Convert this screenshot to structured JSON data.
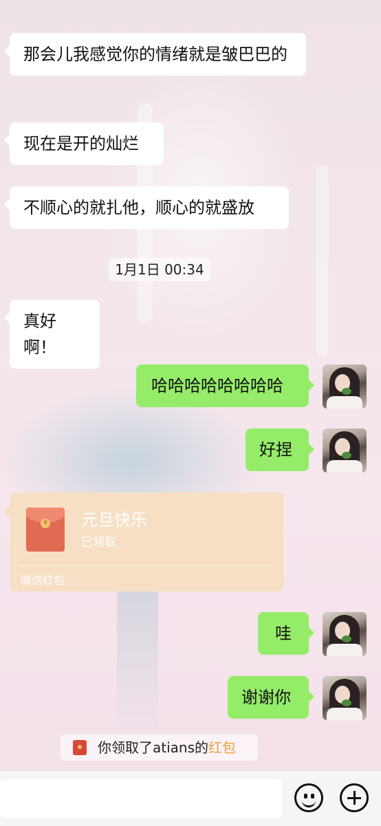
{
  "messages": [
    {
      "side": "left",
      "text": "那会儿我感觉你的情绪就是皱巴巴的"
    },
    {
      "side": "left",
      "text": "现在是开的灿烂"
    },
    {
      "side": "left",
      "text": "不顺心的就扎他，顺心的就盛放"
    },
    {
      "side": "left",
      "text": "真好啊！"
    },
    {
      "side": "right",
      "text": "哈哈哈哈哈哈哈哈"
    },
    {
      "side": "right",
      "text": "好捏"
    },
    {
      "side": "right",
      "text": "哇"
    },
    {
      "side": "right",
      "text": "谢谢你"
    }
  ],
  "timestamp": "1月1日 00:34",
  "red_packet": {
    "title": "元旦快乐",
    "status": "已领取",
    "source": "微信红包"
  },
  "system_note": {
    "prefix": "你领取了atians的",
    "accent": "红包"
  },
  "input_bar": {
    "placeholder": "",
    "emoji_icon": "smiley-icon",
    "more_icon": "plus-icon"
  },
  "colors": {
    "incoming_bubble": "#ffffff",
    "outgoing_bubble": "#95ec69",
    "red_packet_bg": "#f6dfc4",
    "accent": "#e8a23e"
  }
}
